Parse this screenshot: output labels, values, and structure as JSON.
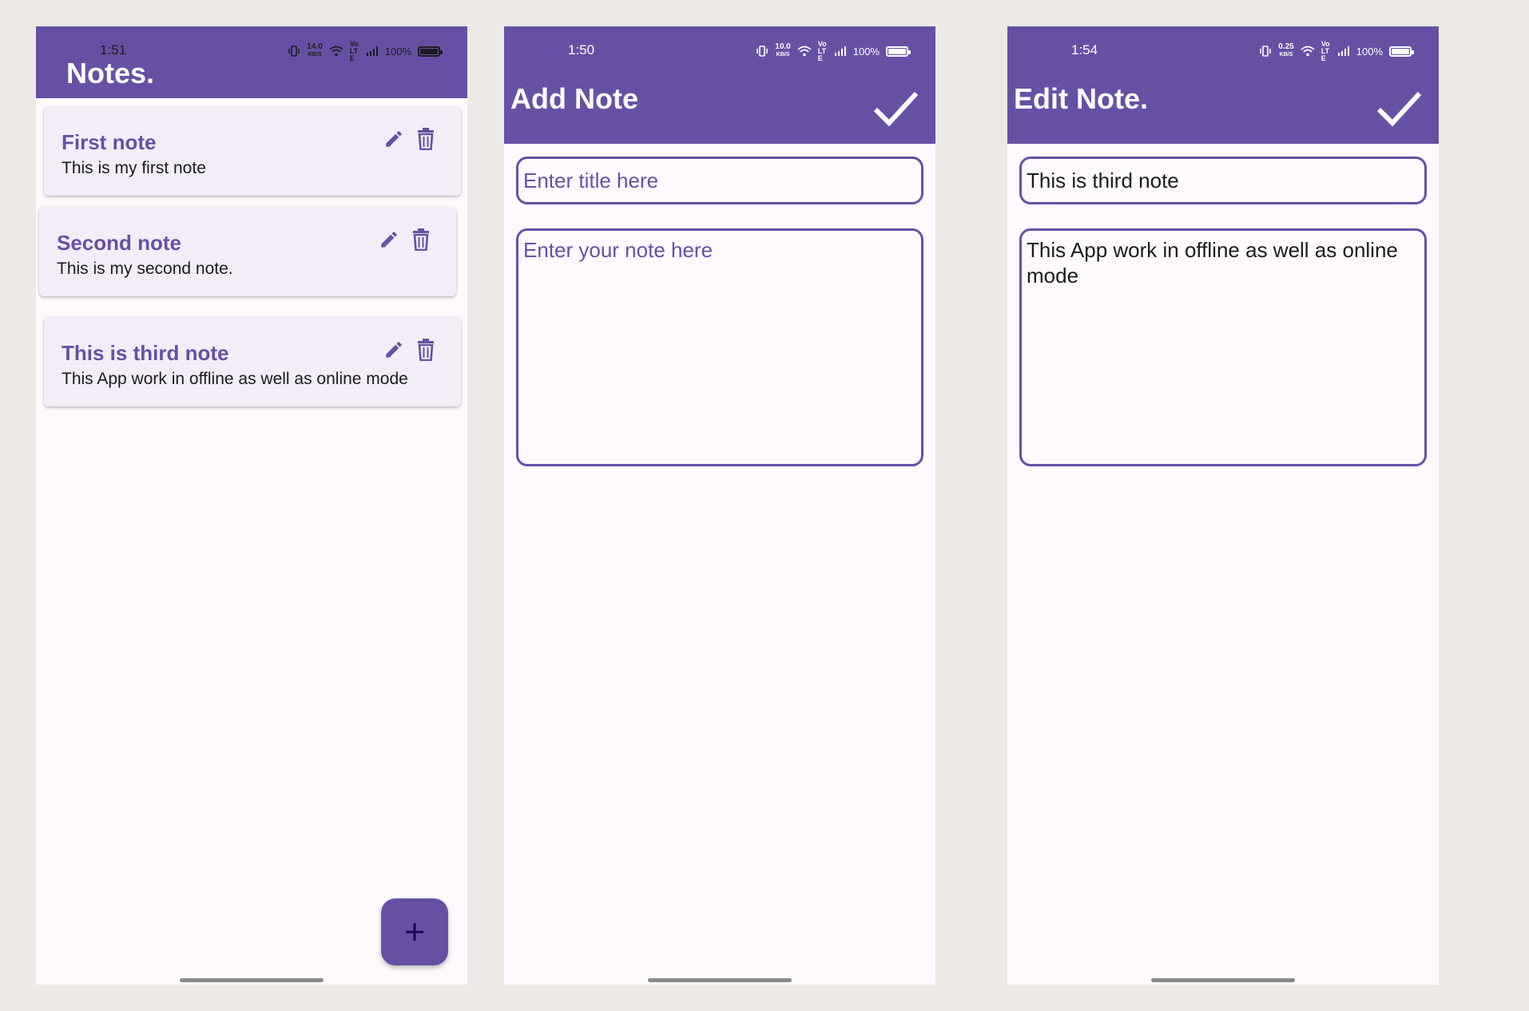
{
  "colors": {
    "primary": "#6750A4",
    "surface": "#FEF9FD",
    "card": "#F3EDF7",
    "on_primary": "#FFFFFF",
    "background": "#ECE9E7"
  },
  "notes_screen": {
    "status": {
      "time": "1:51",
      "net_speed_top": "14.0",
      "net_speed_unit": "KB/S",
      "volte": "Vo LTE",
      "battery": "100%"
    },
    "title": "Notes.",
    "notes": [
      {
        "title": "First note",
        "body": "This is my first note"
      },
      {
        "title": "Second note",
        "body": "This is my second note."
      },
      {
        "title": "This is third note",
        "body": "This App work in offline as well as online mode"
      }
    ],
    "icons": {
      "edit": "pencil-icon",
      "delete": "trash-icon",
      "add": "plus-icon"
    }
  },
  "add_screen": {
    "status": {
      "time": "1:50",
      "net_speed_top": "10.0",
      "net_speed_unit": "KB/S",
      "volte": "Vo LTE",
      "battery": "100%"
    },
    "title": "Add Note",
    "title_placeholder": "Enter title here",
    "body_placeholder": "Enter your note here",
    "title_value": "",
    "body_value": "",
    "icons": {
      "save": "check-icon"
    }
  },
  "edit_screen": {
    "status": {
      "time": "1:54",
      "net_speed_top": "0.25",
      "net_speed_unit": "KB/S",
      "volte": "Vo LTE",
      "battery": "100%"
    },
    "title": "Edit Note.",
    "title_value": "This is third note",
    "body_value": "This App work in offline as well as online mode",
    "icons": {
      "save": "check-icon"
    }
  }
}
